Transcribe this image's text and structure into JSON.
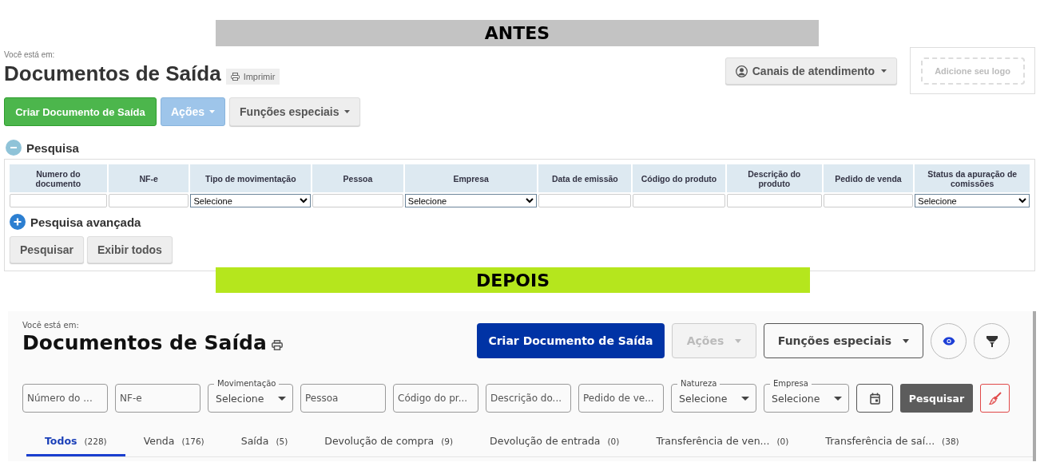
{
  "before": {
    "banner": "ANTES",
    "breadcrumb": "Você está em:",
    "title": "Documentos de Saída",
    "print_button": "Imprimir",
    "support_button": "Canais de atendimento",
    "logo_placeholder": "Adicione seu logo",
    "actions": [
      {
        "label": "Criar Documento de Saída",
        "kind": "primary",
        "dropdown": false
      },
      {
        "label": "Ações",
        "kind": "secondary",
        "dropdown": true
      },
      {
        "label": "Funções especiais",
        "kind": "default",
        "dropdown": true
      }
    ],
    "search": {
      "title": "Pesquisa",
      "expanded": true,
      "columns": [
        {
          "label": "Numero do documento",
          "kind": "text"
        },
        {
          "label": "NF-e",
          "kind": "text"
        },
        {
          "label": "Tipo de movimentação",
          "kind": "select",
          "value": "Selecione"
        },
        {
          "label": "Pessoa",
          "kind": "text"
        },
        {
          "label": "Empresa",
          "kind": "select",
          "value": "Selecione"
        },
        {
          "label": "Data de emissão",
          "kind": "text"
        },
        {
          "label": "Código do produto",
          "kind": "text"
        },
        {
          "label": "Descrição do produto",
          "kind": "text"
        },
        {
          "label": "Pedido de venda",
          "kind": "text"
        },
        {
          "label": "Status da apuração de comissões",
          "kind": "select",
          "value": "Selecione"
        }
      ],
      "advanced": {
        "label": "Pesquisa avançada",
        "expanded": false
      },
      "buttons": [
        "Pesquisar",
        "Exibir todos"
      ]
    }
  },
  "after": {
    "banner": "DEPOIS",
    "breadcrumb": "Você está em:",
    "title": "Documentos de Saída",
    "actions": [
      {
        "label": "Criar Documento de Saída",
        "kind": "primary",
        "disabled": false
      },
      {
        "label": "Ações",
        "kind": "dropdown",
        "disabled": true
      },
      {
        "label": "Funções especiais",
        "kind": "dropdown",
        "disabled": false
      },
      {
        "kind": "eye"
      },
      {
        "kind": "filter"
      }
    ],
    "filters": [
      {
        "kind": "text",
        "placeholder": "Número do ..."
      },
      {
        "kind": "text",
        "placeholder": "NF-e"
      },
      {
        "kind": "select",
        "label": "Movimentação",
        "value": "Selecione"
      },
      {
        "kind": "text",
        "placeholder": "Pessoa"
      },
      {
        "kind": "text",
        "placeholder": "Código do pr..."
      },
      {
        "kind": "text",
        "placeholder": "Descrição do..."
      },
      {
        "kind": "text",
        "placeholder": "Pedido de ve..."
      },
      {
        "kind": "select",
        "label": "Natureza",
        "value": "Selecione"
      },
      {
        "kind": "select",
        "label": "Empresa",
        "value": "Selecione"
      },
      {
        "kind": "calendar"
      },
      {
        "kind": "search",
        "label": "Pesquisar"
      },
      {
        "kind": "clear"
      }
    ],
    "tabs": [
      {
        "label": "Todos",
        "count": "(228)",
        "selected": true
      },
      {
        "label": "Venda",
        "count": "(176)",
        "selected": false
      },
      {
        "label": "Saída",
        "count": "(5)",
        "selected": false
      },
      {
        "label": "Devolução de compra",
        "count": "(9)",
        "selected": false
      },
      {
        "label": "Devolução de entrada",
        "count": "(0)",
        "selected": false
      },
      {
        "label": "Transferência de ven...",
        "count": "(0)",
        "selected": false
      },
      {
        "label": "Transferência de saí...",
        "count": "(38)",
        "selected": false
      }
    ]
  }
}
